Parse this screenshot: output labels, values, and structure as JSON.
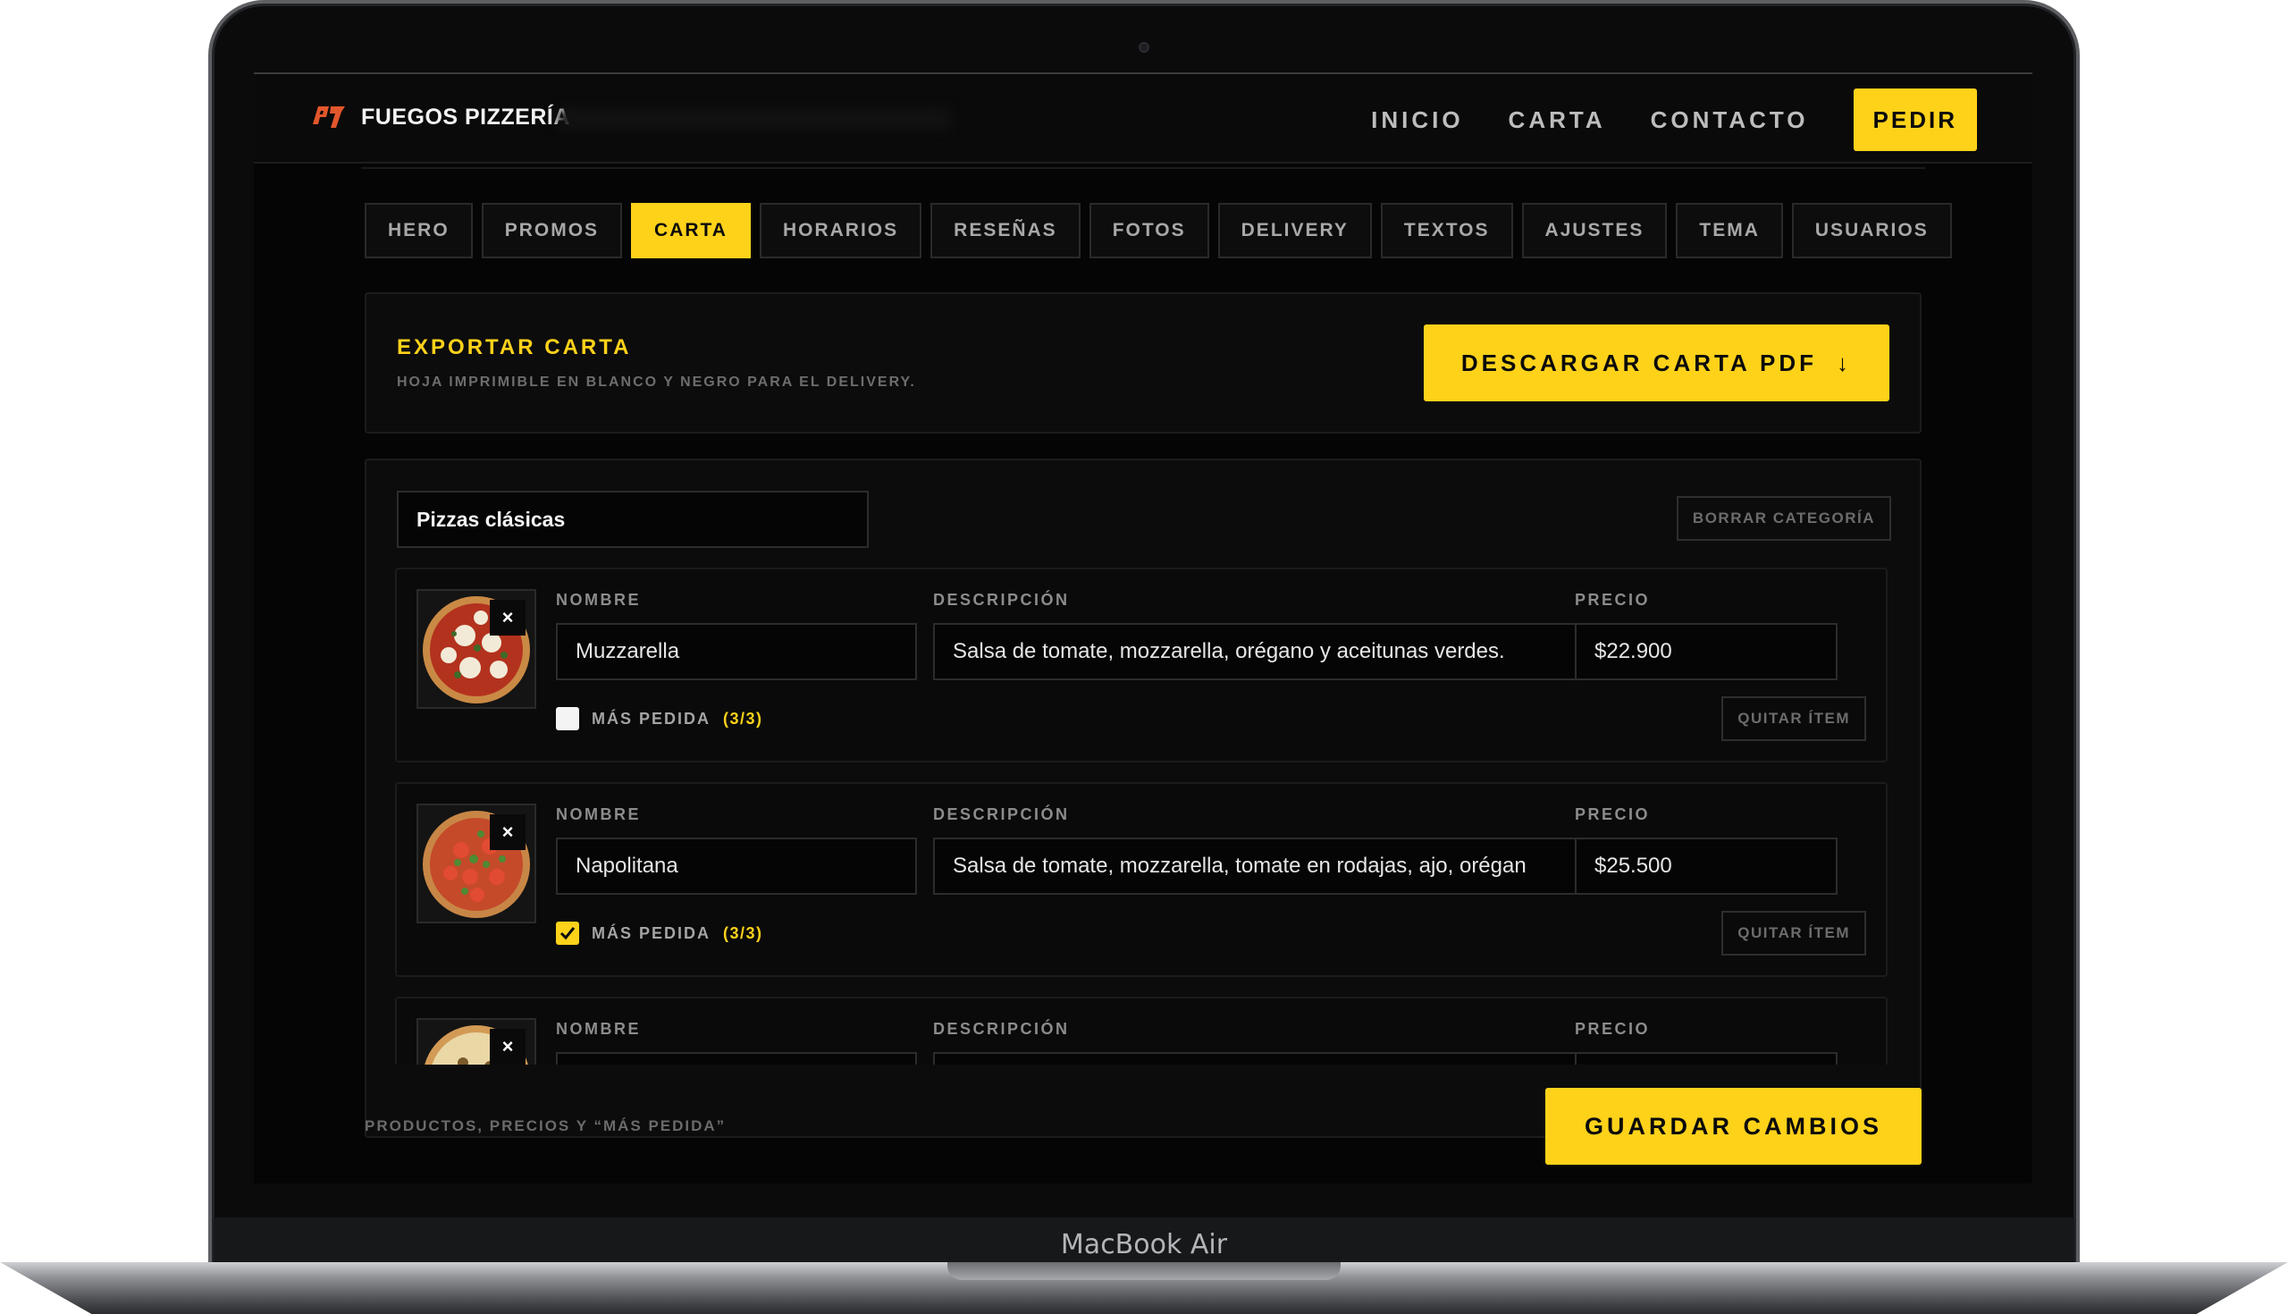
{
  "device": {
    "label": "MacBook Air"
  },
  "nav": {
    "brand": "FUEGOS PIZZERÍA",
    "links": [
      "INICIO",
      "CARTA",
      "CONTACTO"
    ],
    "cta": "PEDIR"
  },
  "tabs": [
    "HERO",
    "PROMOS",
    "CARTA",
    "HORARIOS",
    "RESEÑAS",
    "FOTOS",
    "DELIVERY",
    "TEXTOS",
    "AJUSTES",
    "TEMA",
    "USUARIOS"
  ],
  "active_tab": "CARTA",
  "export": {
    "title": "EXPORTAR CARTA",
    "subtitle": "HOJA IMPRIMIBLE EN BLANCO Y NEGRO PARA EL DELIVERY.",
    "button": "DESCARGAR CARTA PDF",
    "button_icon": "↓"
  },
  "category": {
    "name": "Pizzas clásicas",
    "delete_label": "BORRAR CATEGORÍA",
    "field_labels": {
      "name": "NOMBRE",
      "description": "DESCRIPCIÓN",
      "price": "PRECIO"
    },
    "items": [
      {
        "name": "Muzzarella",
        "description": "Salsa de tomate, mozzarella, orégano y aceitunas verdes.",
        "price": "$22.900",
        "best_seller_label": "MÁS PEDIDA",
        "best_seller_count": "(3/3)",
        "best_seller": false,
        "remove_label": "QUITAR ÍTEM",
        "remove_image": "×"
      },
      {
        "name": "Napolitana",
        "description": "Salsa de tomate, mozzarella, tomate en rodajas, ajo, orégan",
        "price": "$25.500",
        "best_seller_label": "MÁS PEDIDA",
        "best_seller_count": "(3/3)",
        "best_seller": true,
        "remove_label": "QUITAR ÍTEM",
        "remove_image": "×"
      },
      {
        "name": "",
        "description": "",
        "price": "",
        "remove_image": "×"
      }
    ]
  },
  "footer": {
    "note": "PRODUCTOS, PRECIOS Y “MÁS PEDIDA”",
    "save": "GUARDAR CAMBIOS"
  },
  "colors": {
    "accent": "#ffd21a",
    "background": "#050505",
    "logo": "#e2572b"
  }
}
